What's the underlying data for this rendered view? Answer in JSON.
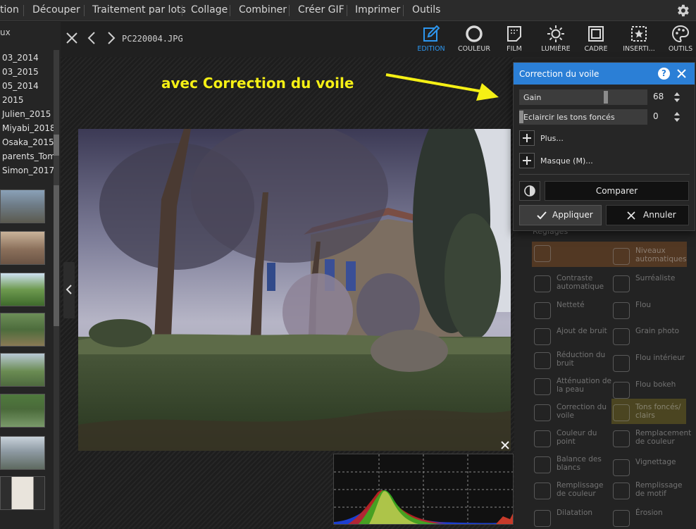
{
  "menu": {
    "items": [
      "tion",
      "Découper",
      "Traitement par lots",
      "Collage",
      "Combiner",
      "Créer GIF",
      "Imprimer",
      "Outils"
    ],
    "settings_icon": "gear-icon"
  },
  "sidebar": {
    "header": "ux",
    "folders": [
      "03_2014",
      "03_2015",
      "05_2014",
      "2015",
      "Julien_2015",
      "Miyabi_2018",
      "Osaka_2015",
      "parents_Tom",
      "Simon_2017"
    ]
  },
  "viewer_header": {
    "filename": "PC220004.JPG",
    "tools": [
      "EDITION",
      "COULEUR",
      "FILM",
      "LUMIÈRE",
      "CADRE",
      "INSERTI...",
      "OUTILS"
    ],
    "active_tool": "EDITION",
    "accent": "#2d96ee"
  },
  "annotation": {
    "text": "avec Correction du voile",
    "color": "#f5f015"
  },
  "dialog": {
    "title": "Correction du voile",
    "gain_label": "Gain",
    "gain_value": "68",
    "gain_level": 0.68,
    "shadows_label": "Eclaircir les tons foncés",
    "shadows_value": "0",
    "shadows_level": 0.0,
    "more_label": "Plus...",
    "mask_label": "Masque (M)...",
    "compare_label": "Comparer",
    "apply_label": "Appliquer",
    "cancel_label": "Annuler",
    "title_color": "#2b7fd6"
  },
  "right_panel": {
    "section_label": "Réglages",
    "tools": [
      "",
      "Niveaux automatiques",
      "Contraste automatique",
      "Surréaliste",
      "Netteté",
      "Flou",
      "Ajout de bruit",
      "Grain photo",
      "Réduction du bruit",
      "Flou intérieur",
      "Atténuation de la peau",
      "Flou bokeh",
      "Correction du voile",
      "Tons foncés/ clairs",
      "Couleur du point",
      "Remplacement de couleur",
      "Balance des blancs",
      "Vignettage",
      "Remplissage de couleur",
      "Remplissage de motif",
      "Dilatation",
      "Érosion"
    ]
  }
}
